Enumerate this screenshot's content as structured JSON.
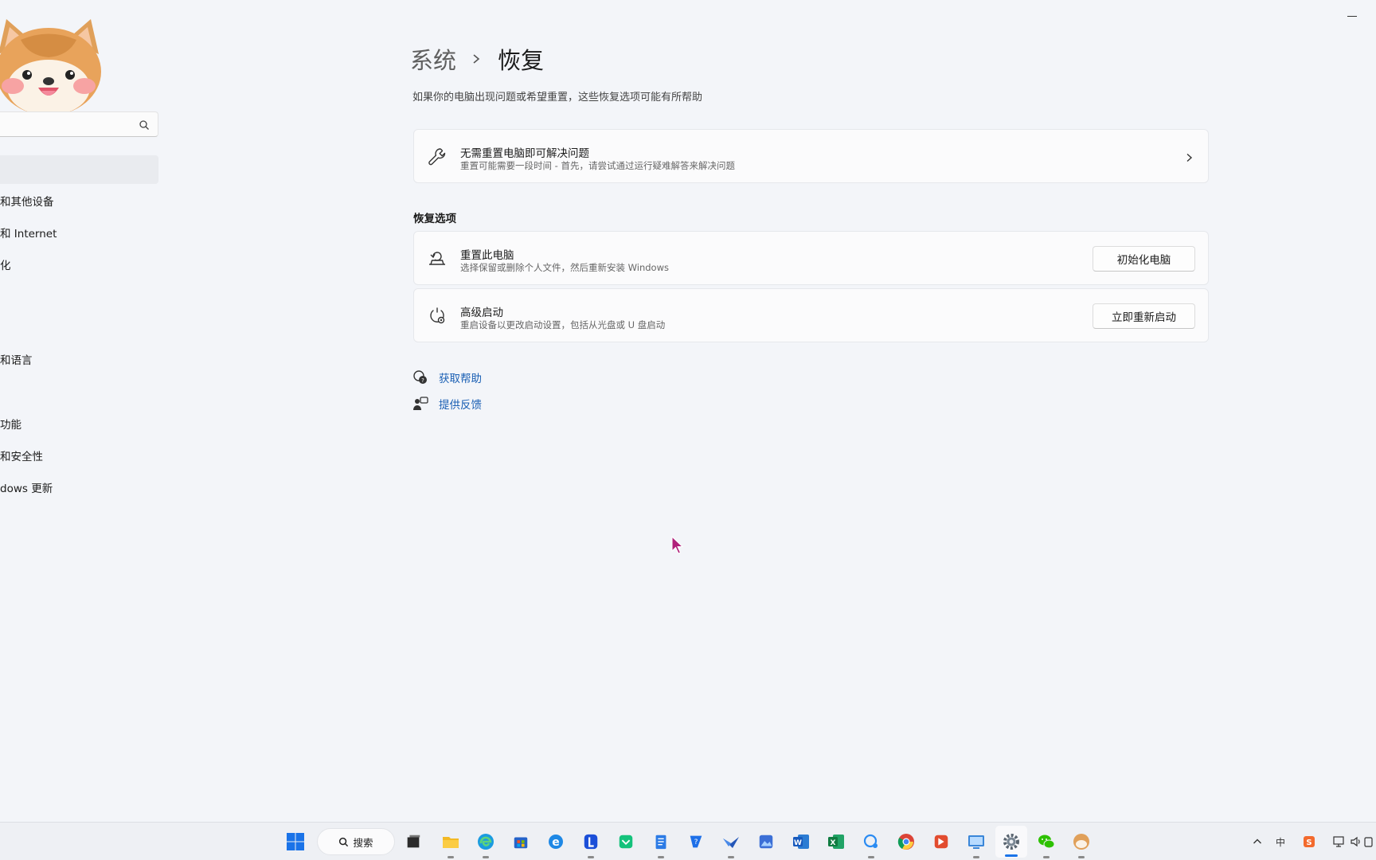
{
  "window": {
    "minimize_label": ""
  },
  "sidebar": {
    "search_placeholder": "",
    "items": [
      {
        "label": "和其他设备"
      },
      {
        "label": "和 Internet"
      },
      {
        "label": "化"
      },
      {
        "label": "和语言"
      },
      {
        "label": "功能"
      },
      {
        "label": "和安全性"
      },
      {
        "label": "dows 更新"
      }
    ]
  },
  "header": {
    "breadcrumb_parent": "系统",
    "breadcrumb_current": "恢复",
    "subtitle": "如果你的电脑出现问题或希望重置，这些恢复选项可能有所帮助"
  },
  "troubleshoot": {
    "title": "无需重置电脑即可解决问题",
    "description": "重置可能需要一段时间 - 首先，请尝试通过运行疑难解答来解决问题"
  },
  "recovery": {
    "section_title": "恢复选项",
    "reset": {
      "title": "重置此电脑",
      "description": "选择保留或删除个人文件，然后重新安装 Windows",
      "button": "初始化电脑"
    },
    "advanced": {
      "title": "高级启动",
      "description": "重启设备以更改启动设置，包括从光盘或 U 盘启动",
      "button": "立即重新启动"
    }
  },
  "links": {
    "get_help": "获取帮助",
    "feedback": "提供反馈"
  },
  "taskbar": {
    "search_label": "搜索",
    "tray": {
      "ime": "中"
    }
  },
  "colors": {
    "background": "#f3f5f9",
    "card": "#fbfbfc",
    "link": "#1a5fb4",
    "accent": "#1a73e8"
  }
}
